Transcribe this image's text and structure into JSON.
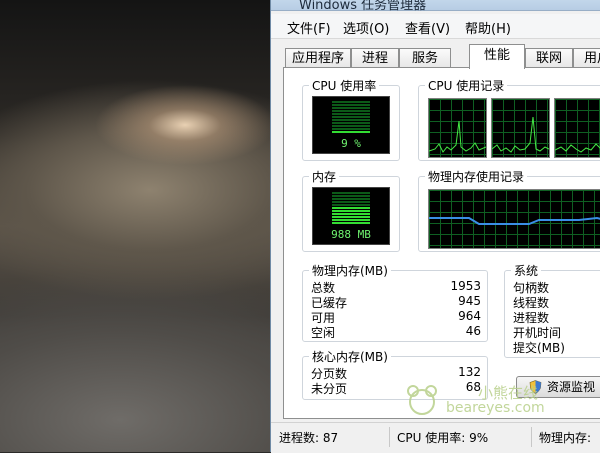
{
  "window": {
    "title": "Windows 任务管理器"
  },
  "menu": [
    {
      "label": "文件(F)"
    },
    {
      "label": "选项(O)"
    },
    {
      "label": "查看(V)"
    },
    {
      "label": "帮助(H)"
    }
  ],
  "tabs": [
    {
      "label": "应用程序",
      "active": false
    },
    {
      "label": "进程",
      "active": false
    },
    {
      "label": "服务",
      "active": false
    },
    {
      "label": "性能",
      "active": true
    },
    {
      "label": "联网",
      "active": false
    },
    {
      "label": "用户",
      "active": false
    }
  ],
  "cpu_usage": {
    "title": "CPU 使用率",
    "value_label": "9 %",
    "percent": 9
  },
  "cpu_history": {
    "title": "CPU 使用记录"
  },
  "memory": {
    "title": "内存",
    "value_label": "988 MB",
    "fraction": 0.5
  },
  "memory_history": {
    "title": "物理内存使用记录"
  },
  "physical_memory": {
    "title": "物理内存(MB)",
    "rows": [
      {
        "label": "总数",
        "value": "1953"
      },
      {
        "label": "已缓存",
        "value": "945"
      },
      {
        "label": "可用",
        "value": "964"
      },
      {
        "label": "空闲",
        "value": "46"
      }
    ]
  },
  "kernel_memory": {
    "title": "核心内存(MB)",
    "rows": [
      {
        "label": "分页数",
        "value": "132"
      },
      {
        "label": "未分页",
        "value": "68"
      }
    ]
  },
  "system": {
    "title": "系统",
    "rows": [
      {
        "label": "句柄数"
      },
      {
        "label": "线程数"
      },
      {
        "label": "进程数"
      },
      {
        "label": "开机时间"
      },
      {
        "label": "提交(MB)"
      }
    ]
  },
  "resource_monitor_button": {
    "label": "资源监视"
  },
  "status": {
    "processes": "进程数: 87",
    "cpu": "CPU 使用率: 9%",
    "memory": "物理内存:"
  },
  "watermark": {
    "line1": "小熊在线",
    "line2": "beareyes.com"
  },
  "colors": {
    "graph_line": "#45e845",
    "memory_line": "#3a8ee6",
    "meter_on": "#33dd33",
    "meter_off": "#0c5a18"
  }
}
